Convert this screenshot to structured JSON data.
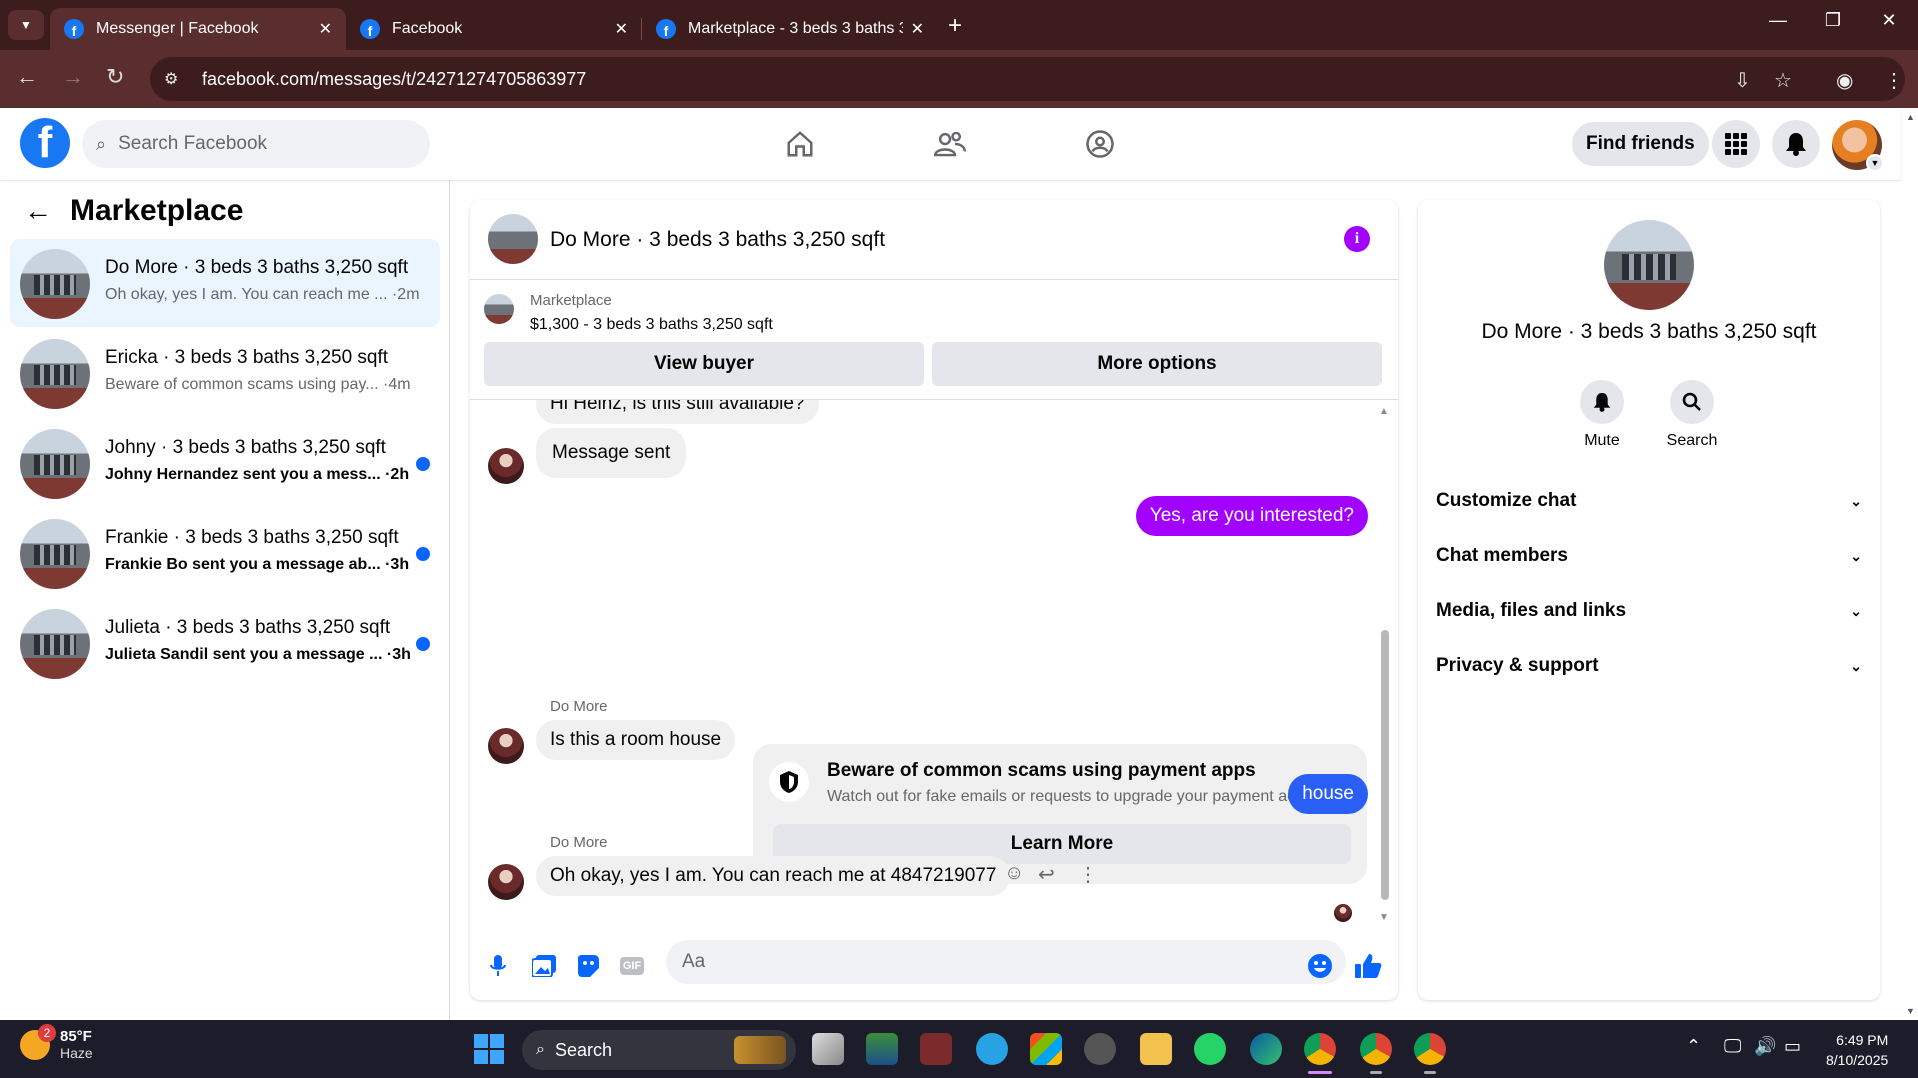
{
  "browser": {
    "tabs": [
      {
        "title": "Messenger | Facebook",
        "active": true
      },
      {
        "title": "Facebook",
        "active": false
      },
      {
        "title": "Marketplace - 3 beds 3 baths 3,",
        "active": false
      }
    ],
    "url": "facebook.com/messages/t/24271274705863977"
  },
  "header": {
    "logo": "f",
    "search_placeholder": "Search Facebook",
    "find_friends": "Find friends"
  },
  "left": {
    "title": "Marketplace",
    "conversations": [
      {
        "title": "Do More · 3 beds 3 baths 3,250 sqft",
        "preview": "Oh okay, yes I am. You can reach me ... ·2m",
        "unread": false,
        "active": true
      },
      {
        "title": "Ericka · 3 beds 3 baths 3,250 sqft",
        "preview": "Beware of common scams using pay... ·4m",
        "unread": false,
        "active": false
      },
      {
        "title": "Johny · 3 beds 3 baths 3,250 sqft",
        "preview": "Johny Hernandez sent you a mess... ·2h",
        "unread": true,
        "active": false
      },
      {
        "title": "Frankie · 3 beds 3 baths 3,250 sqft",
        "preview": "Frankie Bo sent you a message ab... ·3h",
        "unread": true,
        "active": false
      },
      {
        "title": "Julieta · 3 beds 3 baths 3,250 sqft",
        "preview": "Julieta Sandil sent you a message ... ·3h",
        "unread": true,
        "active": false
      }
    ]
  },
  "chat": {
    "title": "Do More · 3 beds 3 baths 3,250 sqft",
    "marketplace_label": "Marketplace",
    "listing": "$1,300 - 3 beds 3 baths 3,250 sqft",
    "view_buyer": "View buyer",
    "more_options": "More options",
    "messages": {
      "m0": "Hi Heinz, is this still available?",
      "m1": "Message sent",
      "m2": "Yes, are you interested?",
      "scam_title": "Beware of common scams using payment apps",
      "scam_desc": "Watch out for fake emails or requests to upgrade your payment account.",
      "learn_more": "Learn More",
      "sender1": "Do More",
      "m3": "Is this a room house",
      "m4": "house",
      "sender2": "Do More",
      "m5": "Oh okay, yes I am. You can reach me at 4847219077"
    },
    "composer_placeholder": "Aa",
    "gif_label": "GIF"
  },
  "right": {
    "name": "Do More · 3 beds 3 baths 3,250 sqft",
    "mute": "Mute",
    "search": "Search",
    "rows": [
      "Customize chat",
      "Chat members",
      "Media, files and links",
      "Privacy & support"
    ]
  },
  "taskbar": {
    "temp": "85°F",
    "weather": "Haze",
    "badge": "2",
    "search": "Search",
    "time": "6:49 PM",
    "date": "8/10/2025"
  },
  "colors": {
    "brand": "#1877f2",
    "outgoing": "#a200ff",
    "outgoing_alt": "#2a5ff5",
    "unread_dot": "#0866ff",
    "chrome": "#3c1c1c"
  }
}
